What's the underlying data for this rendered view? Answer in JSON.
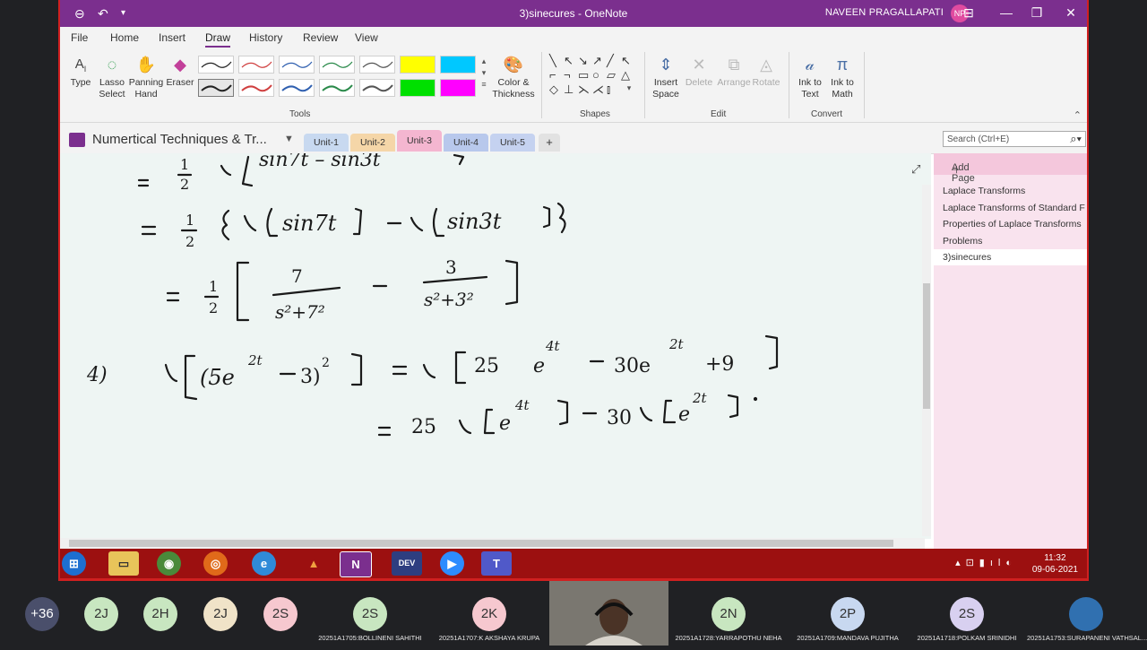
{
  "window": {
    "title": "3)sinecures - OneNote",
    "user_name": "NAVEEN PRAGALLAPATI",
    "user_initials": "NP"
  },
  "menu_tabs": [
    "File",
    "Home",
    "Insert",
    "Draw",
    "History",
    "Review",
    "View"
  ],
  "ribbon": {
    "tools": {
      "type_label": "Type",
      "lasso_label": "Lasso Select",
      "panning_label": "Panning Hand",
      "eraser_label": "Eraser",
      "color_label": "Color & Thickness",
      "group_label": "Tools"
    },
    "shapes_group_label": "Shapes",
    "edit": {
      "insert_space_label": "Insert Space",
      "delete_label": "Delete",
      "arrange_label": "Arrange",
      "rotate_label": "Rotate",
      "group_label": "Edit"
    },
    "convert": {
      "ink_to_text_label": "Ink to Text",
      "ink_to_math_label": "Ink to Math",
      "group_label": "Convert"
    },
    "pen_colors": [
      "#222222",
      "#d04040",
      "#3060b0",
      "#2a8a4a",
      "#555555",
      "#ffff00",
      "#00c8ff",
      "#222222",
      "#d04040",
      "#3060b0",
      "#2a8a4a",
      "#555555",
      "#00e000",
      "#ff00ff"
    ]
  },
  "notebook": {
    "name": "Numertical Techniques & Tr...",
    "sections": [
      "Unit-1",
      "Unit-2",
      "Unit-3",
      "Unit-4",
      "Unit-5"
    ],
    "add_section": "+",
    "search_placeholder": "Search (Ctrl+E)"
  },
  "pages": {
    "add_page_label": "Add Page",
    "items": [
      "Laplace Transforms",
      "Laplace Transforms of Standard F",
      "Properties of Laplace Transforms",
      "Problems",
      "3)sinecures"
    ],
    "selected_index": 4
  },
  "taskbar": {
    "time": "11:32",
    "date": "09-06-2021"
  },
  "participants": [
    {
      "initials": "+36",
      "name": "",
      "color": "#4a4f6b"
    },
    {
      "initials": "2J",
      "name": "",
      "color": "#c8e6c0"
    },
    {
      "initials": "2H",
      "name": "",
      "color": "#c8e6c0"
    },
    {
      "initials": "2J",
      "name": "",
      "color": "#f0e3c8"
    },
    {
      "initials": "2S",
      "name": "",
      "color": "#f6c8cf"
    },
    {
      "initials": "2S",
      "name": "20251A1705:BOLLINENI SAHITHI",
      "color": "#c8e6c0"
    },
    {
      "initials": "2K",
      "name": "20251A1707:K AKSHAYA KRUPA",
      "color": "#f6c8cf"
    },
    {
      "initials": "2N",
      "name": "20251A1728:YARRAPOTHU NEHA",
      "color": "#c8e6c0"
    },
    {
      "initials": "2P",
      "name": "20251A1709:MANDAVA PUJITHA",
      "color": "#c8d8f0"
    },
    {
      "initials": "2S",
      "name": "20251A1718:POLKAM SRINIDHI",
      "color": "#d8d0f0"
    },
    {
      "initials": "",
      "name": "20251A1753:SURAPANENI VATHSAL...",
      "color": "#3070b0"
    }
  ]
}
